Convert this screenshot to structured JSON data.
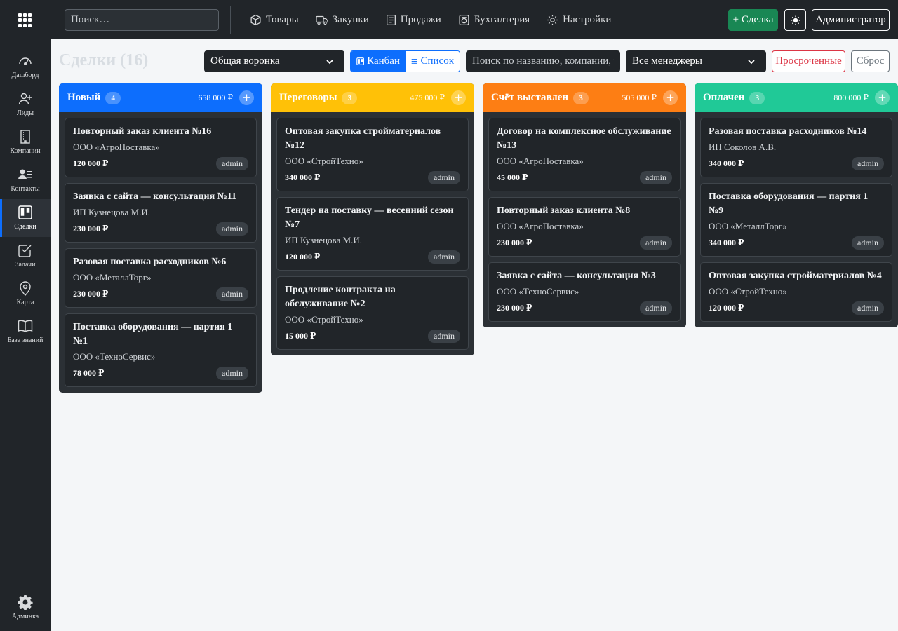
{
  "topbar": {
    "search_placeholder": "Поиск…",
    "nav": [
      {
        "label": "Товары",
        "icon": "box-icon"
      },
      {
        "label": "Закупки",
        "icon": "truck-icon"
      },
      {
        "label": "Продажи",
        "icon": "receipt-icon"
      },
      {
        "label": "Бухгалтерия",
        "icon": "piggy-bank-icon"
      },
      {
        "label": "Настройки",
        "icon": "gear-icon"
      }
    ],
    "new_deal_label": "+ Сделка",
    "user_label": "Администратор"
  },
  "sidebar": {
    "items": [
      {
        "label": "Дашборд",
        "icon": "speedometer-icon"
      },
      {
        "label": "Лиды",
        "icon": "person-plus-icon"
      },
      {
        "label": "Компании",
        "icon": "building-icon"
      },
      {
        "label": "Контакты",
        "icon": "contacts-icon"
      },
      {
        "label": "Сделки",
        "icon": "kanban-icon",
        "active": true
      },
      {
        "label": "Задачи",
        "icon": "check-square-icon"
      },
      {
        "label": "Карта",
        "icon": "map-pin-icon"
      },
      {
        "label": "База знаний",
        "icon": "book-icon"
      }
    ],
    "admin_label": "Админка"
  },
  "toolbar": {
    "title": "Сделки (16)",
    "pipeline_select": "Общая воронка",
    "view_kanban": "Канбан",
    "view_list": "Список",
    "search_placeholder": "Поиск по названию, компании, т",
    "manager_select": "Все менеджеры",
    "overdue_label": "Просроченные",
    "reset_label": "Сброс"
  },
  "colors": {
    "col_new": "#0d6efd",
    "col_negotiation": "#ffc107",
    "col_invoice": "#fd7e14",
    "col_paid": "#20c997"
  },
  "columns": [
    {
      "title": "Новый",
      "count": "4",
      "sum": "658 000 ₽",
      "cards": [
        {
          "title": "Повторный заказ клиента №16",
          "company": "ООО «АгроПоставка»",
          "amount": "120 000 ₽",
          "user": "admin"
        },
        {
          "title": "Заявка с сайта — консультация №11",
          "company": "ИП Кузнецова М.И.",
          "amount": "230 000 ₽",
          "user": "admin"
        },
        {
          "title": "Разовая поставка расходников №6",
          "company": "ООО «МеталлТорг»",
          "amount": "230 000 ₽",
          "user": "admin"
        },
        {
          "title": "Поставка оборудования — партия 1 №1",
          "company": "ООО «ТехноСервис»",
          "amount": "78 000 ₽",
          "user": "admin"
        }
      ]
    },
    {
      "title": "Переговоры",
      "count": "3",
      "sum": "475 000 ₽",
      "cards": [
        {
          "title": "Оптовая закупка стройматериалов №12",
          "company": "ООО «СтройТехно»",
          "amount": "340 000 ₽",
          "user": "admin"
        },
        {
          "title": "Тендер на поставку — весенний сезон №7",
          "company": "ИП Кузнецова М.И.",
          "amount": "120 000 ₽",
          "user": "admin"
        },
        {
          "title": "Продление контракта на обслуживание №2",
          "company": "ООО «СтройТехно»",
          "amount": "15 000 ₽",
          "user": "admin"
        }
      ]
    },
    {
      "title": "Счёт выставлен",
      "count": "3",
      "sum": "505 000 ₽",
      "cards": [
        {
          "title": "Договор на комплексное обслуживание №13",
          "company": "ООО «АгроПоставка»",
          "amount": "45 000 ₽",
          "user": "admin"
        },
        {
          "title": "Повторный заказ клиента №8",
          "company": "ООО «АгроПоставка»",
          "amount": "230 000 ₽",
          "user": "admin"
        },
        {
          "title": "Заявка с сайта — консультация №3",
          "company": "ООО «ТехноСервис»",
          "amount": "230 000 ₽",
          "user": "admin"
        }
      ]
    },
    {
      "title": "Оплачен",
      "count": "3",
      "sum": "800 000 ₽",
      "cards": [
        {
          "title": "Разовая поставка расходников №14",
          "company": "ИП Соколов А.В.",
          "amount": "340 000 ₽",
          "user": "admin"
        },
        {
          "title": "Поставка оборудования — партия 1 №9",
          "company": "ООО «МеталлТорг»",
          "amount": "340 000 ₽",
          "user": "admin"
        },
        {
          "title": "Оптовая закупка стройматериалов №4",
          "company": "ООО «СтройТехно»",
          "amount": "120 000 ₽",
          "user": "admin"
        }
      ]
    }
  ]
}
